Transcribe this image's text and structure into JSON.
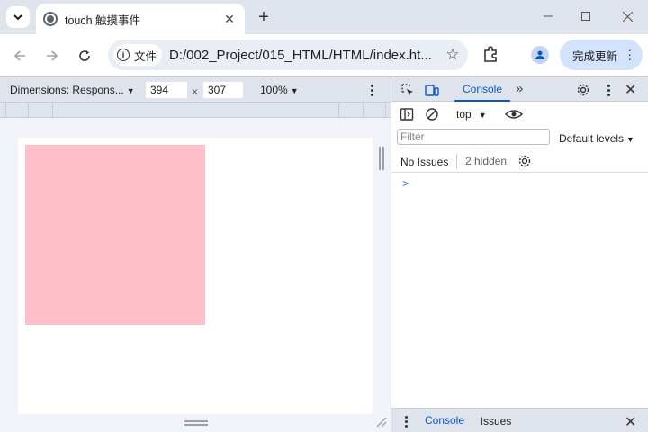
{
  "browser": {
    "tab": {
      "title": "touch 触摸事件",
      "favicon": "globe-icon"
    },
    "address_bar": {
      "site_chip_label": "文件",
      "url": "D:/002_Project/015_HTML/HTML/index.ht..."
    },
    "update_button_label": "完成更新"
  },
  "device_toolbar": {
    "dimensions_label": "Dimensions: Respons...",
    "width": "394",
    "height": "307",
    "times_symbol": "×",
    "zoom": "100%"
  },
  "page": {
    "box_color": "#ffc0cb"
  },
  "devtools": {
    "active_tab": "Console",
    "context": "top",
    "filter_placeholder": "Filter",
    "levels_label": "Default levels",
    "no_issues_label": "No Issues",
    "hidden_label": "2 hidden",
    "prompt_symbol": ">",
    "drawer": {
      "tabs": [
        "Console",
        "Issues"
      ]
    }
  },
  "colors": {
    "accent": "#0b57d0",
    "update_button_bg": "#d3e3fd",
    "chrome_bg": "#dfe3eb"
  }
}
